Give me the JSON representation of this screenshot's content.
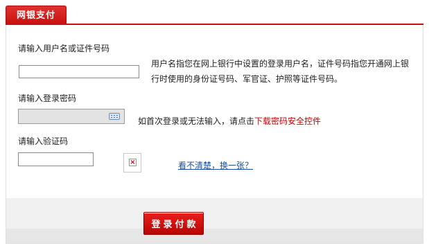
{
  "tab": {
    "title": "网银支付"
  },
  "form": {
    "username": {
      "label": "请输入用户名或证件号码",
      "value": "",
      "hint": "用户名指您在网上银行中设置的登录用户名，证件号码指您开通网上银行时使用的身份证号码、军官证、护照等证件号码。"
    },
    "password": {
      "label": "请输入登录密码",
      "hint_prefix": "如首次登录或无法输入，请点击",
      "hint_link": "下载密码安全控件"
    },
    "captcha": {
      "label": "请输入验证码",
      "value": "",
      "refresh_link": "看不清楚，换一张？"
    }
  },
  "actions": {
    "pay_button": "登录付款"
  },
  "colors": {
    "brand_red": "#c81010",
    "link_red": "#cc0000",
    "link_blue": "#1a4f9c"
  }
}
